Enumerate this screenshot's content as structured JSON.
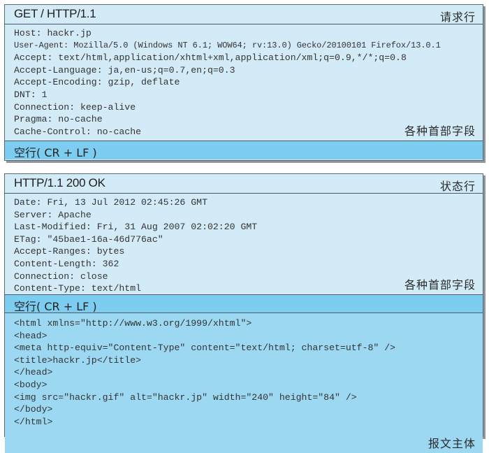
{
  "request": {
    "request_line": "GET / HTTP/1.1",
    "request_line_label": "请求行",
    "headers": [
      "Host: hackr.jp",
      "User-Agent: Mozilla/5.0 (Windows NT 6.1; WOW64; rv:13.0) Gecko/20100101 Firefox/13.0.1",
      "Accept: text/html,application/xhtml+xml,application/xml;q=0.9,*/*;q=0.8",
      "Accept-Language: ja,en-us;q=0.7,en;q=0.3",
      "Accept-Encoding: gzip, deflate",
      "DNT: 1",
      "Connection: keep-alive",
      "Pragma: no-cache",
      "Cache-Control: no-cache"
    ],
    "headers_label": "各种首部字段",
    "blank_line_label": "空行( CR + LF )"
  },
  "response": {
    "status_line": "HTTP/1.1 200 OK",
    "status_line_label": "状态行",
    "headers": [
      "Date: Fri, 13 Jul 2012 02:45:26 GMT",
      "Server: Apache",
      "Last-Modified: Fri, 31 Aug 2007 02:02:20 GMT",
      "ETag: \"45bae1-16a-46d776ac\"",
      "Accept-Ranges: bytes",
      "Content-Length: 362",
      "Connection: close",
      "Content-Type: text/html"
    ],
    "headers_label": "各种首部字段",
    "blank_line_label": "空行( CR + LF )",
    "body_lines": [
      "<html xmlns=\"http://www.w3.org/1999/xhtml\">",
      "<head>",
      "<meta http-equiv=\"Content-Type\" content=\"text/html; charset=utf-8\" />",
      "<title>hackr.jp</title>",
      "</head>",
      "<body>",
      "<img src=\"hackr.gif\" alt=\"hackr.jp\" width=\"240\" height=\"84\" />",
      "</body>",
      "</html>"
    ],
    "body_label": "报文主体"
  },
  "colors": {
    "header_bg": "#d3ebf7",
    "blank_line_bg": "#7dcdf1",
    "body_bg": "#9dd8f3",
    "border": "#5a6a74"
  }
}
